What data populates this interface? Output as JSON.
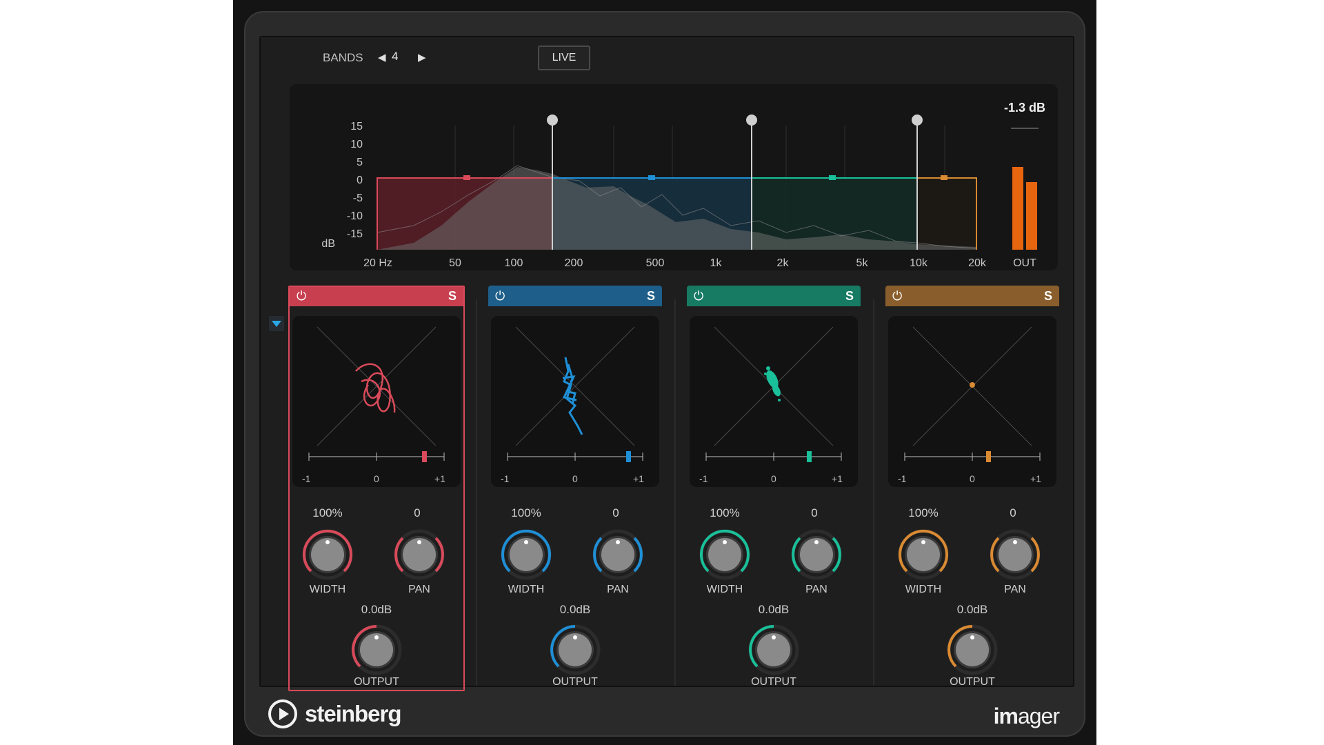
{
  "header": {
    "bands_label": "BANDS",
    "bands_count": "4",
    "live_label": "LIVE"
  },
  "spectrum": {
    "y_ticks": [
      "15",
      "10",
      "5",
      "0",
      "-5",
      "-10",
      "-15"
    ],
    "y_unit": "dB",
    "x_ticks": [
      "20 Hz",
      "50",
      "100",
      "200",
      "500",
      "1k",
      "2k",
      "5k",
      "10k",
      "20k"
    ],
    "out_label": "OUT",
    "out_level": "-1.3 dB"
  },
  "bands": [
    {
      "color": "#d94a5a",
      "header_color": "#c8404f",
      "width_value": "100%",
      "pan_value": "0",
      "output_value": "0.0dB",
      "width_label": "WIDTH",
      "pan_label": "PAN",
      "output_label": "OUTPUT",
      "scale_min": "-1",
      "scale_mid": "0",
      "scale_max": "+1",
      "solo": "S",
      "correlation": 0.68
    },
    {
      "color": "#1e8fd6",
      "header_color": "#1d5f8a",
      "width_value": "100%",
      "pan_value": "0",
      "output_value": "0.0dB",
      "width_label": "WIDTH",
      "pan_label": "PAN",
      "output_label": "OUTPUT",
      "scale_min": "-1",
      "scale_mid": "0",
      "scale_max": "+1",
      "solo": "S",
      "correlation": 0.76
    },
    {
      "color": "#19c09a",
      "header_color": "#177a63",
      "width_value": "100%",
      "pan_value": "0",
      "output_value": "0.0dB",
      "width_label": "WIDTH",
      "pan_label": "PAN",
      "output_label": "OUTPUT",
      "scale_min": "-1",
      "scale_mid": "0",
      "scale_max": "+1",
      "solo": "S",
      "correlation": 0.52
    },
    {
      "color": "#d98a32",
      "header_color": "#8a5e2c",
      "width_value": "100%",
      "pan_value": "0",
      "output_value": "0.0dB",
      "width_label": "WIDTH",
      "pan_label": "PAN",
      "output_label": "OUTPUT",
      "scale_min": "-1",
      "scale_mid": "0",
      "scale_max": "+1",
      "solo": "S",
      "correlation": 0.22
    }
  ],
  "footer": {
    "brand": "steinberg",
    "product_bold": "im",
    "product_rest": "ager"
  }
}
